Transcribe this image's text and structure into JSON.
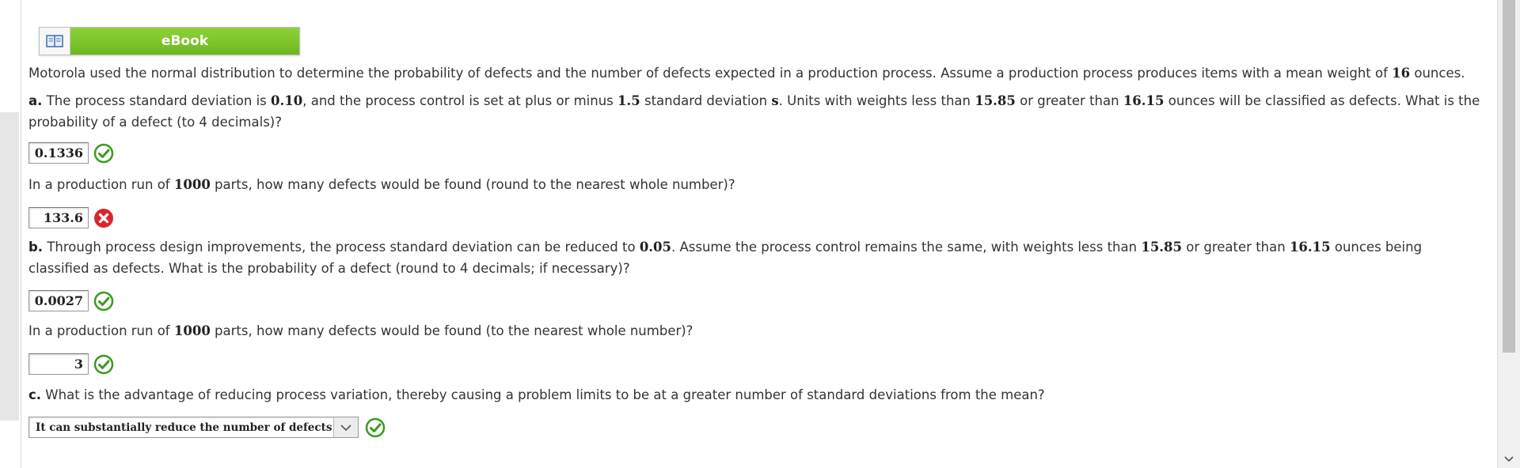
{
  "ebook": {
    "label": "eBook",
    "icon": "book-icon"
  },
  "intro": {
    "before": "Motorola used the normal distribution to determine the probability of defects and the number of defects expected in a production process. Assume a production process produces items with a mean weight of ",
    "mean": "16",
    "after": " ounces."
  },
  "part_a": {
    "letter": "a.",
    "t1": " The process standard deviation is ",
    "sd": "0.10",
    "t2": ", and the process control is set at plus or minus ",
    "k": "1.5",
    "t3": " standard deviation ",
    "s": "s",
    "t4": ". Units with weights less than ",
    "low": "15.85",
    "t5": " or greater than ",
    "high": "16.15",
    "t6": " ounces will be classified as defects. What is the probability of a defect (to 4 decimals)?",
    "answer": "0.1336",
    "answer_status": "correct"
  },
  "run_a": {
    "t1": "In a production run of ",
    "n": "1000",
    "t2": " parts, how many defects would be found (round to the nearest whole number)?",
    "answer": "133.6",
    "answer_status": "incorrect"
  },
  "part_b": {
    "letter": "b.",
    "t1": " Through process design improvements, the process standard deviation can be reduced to ",
    "sd": "0.05",
    "t2": ". Assume the process control remains the same, with weights less than ",
    "low": "15.85",
    "t3": " or greater than ",
    "high": "16.15",
    "t4": " ounces being classified as defects. What is the probability of a defect (round to 4 decimals; if necessary)?",
    "answer": "0.0027",
    "answer_status": "correct"
  },
  "run_b": {
    "t1": "In a production run of ",
    "n": "1000",
    "t2": " parts, how many defects would be found (to the nearest whole number)?",
    "answer": "3",
    "answer_status": "correct"
  },
  "part_c": {
    "letter": "c.",
    "t1": " What is the advantage of reducing process variation, thereby causing a problem limits to be at a greater number of standard deviations from the mean?",
    "selected": "It can substantially reduce the number of defects",
    "answer_status": "correct"
  },
  "colors": {
    "correct": "#3a9a1e",
    "incorrect": "#d9262c",
    "ebook_green": "#7cc42c"
  }
}
